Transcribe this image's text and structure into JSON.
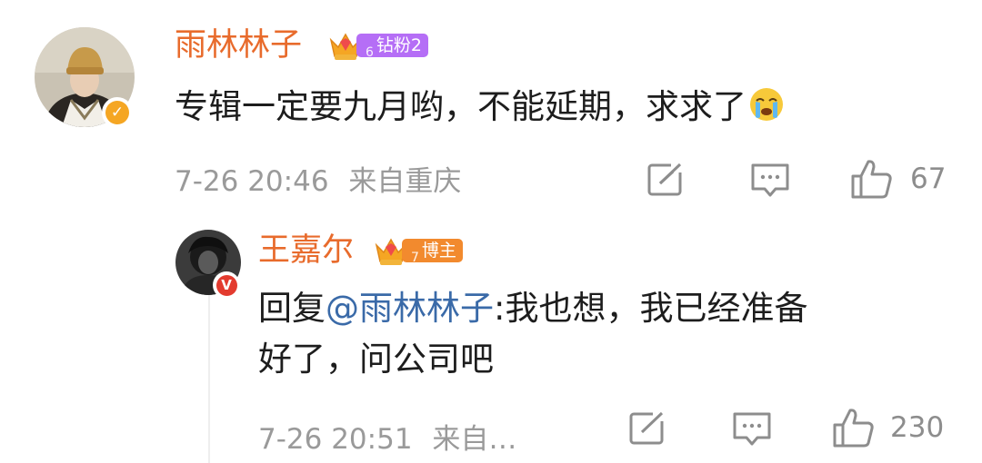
{
  "comment": {
    "username": "雨林林子",
    "badge_level": "6",
    "badge_label": "钻粉2",
    "text": "专辑一定要九月哟，不能延期，求求了",
    "emoji_icon": "crying-face-icon",
    "time": "7-26 20:46",
    "location": "来自重庆",
    "likes": "67",
    "verified_color": "#f5a623"
  },
  "reply": {
    "username": "王嘉尔",
    "badge_level": "7",
    "badge_label": "博主",
    "reply_prefix": "回复",
    "mention": "@雨林林子",
    "text_line1": ":我也想，我已经准备",
    "text_line2": "好了，问公司吧",
    "time": "7-26 20:51",
    "location": "来自…",
    "likes": "230",
    "verified_color": "#e33b2f"
  },
  "colors": {
    "username": "#e86b2c",
    "mention": "#3a6aa8",
    "badge_purple": "#b56ef6",
    "badge_orange": "#f28a2e",
    "meta": "#9a9a9a"
  }
}
